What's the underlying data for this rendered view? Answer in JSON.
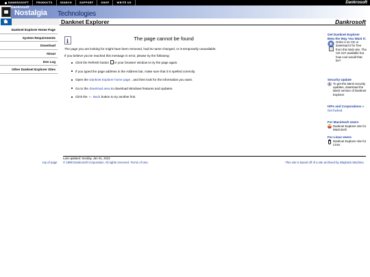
{
  "topnav": {
    "items": [
      "DANKROSOFT",
      "PRODUCTS",
      "SEARCH",
      "SUPPORT",
      "SHOP",
      "WRITE US"
    ],
    "brand": "Dankrosoft"
  },
  "banner": {
    "small_text": "Dankrosoft",
    "title_part1": "Nostalgia",
    "title_part2": "Technologies"
  },
  "titlebar": {
    "page_title": "Danknet Explorer",
    "brand": "Dankrosoft"
  },
  "leftnav": {
    "items": [
      "Danknet Explorer Home Page",
      "System Requirements",
      "Download",
      "About",
      "Dev Log",
      "Other Danknet Explorer Sites"
    ]
  },
  "main": {
    "heading": "The page cannot be found",
    "para1": "The page you are looking for might have been removed, had its name changed, or is temporarily unavailable.",
    "para2": "If you believe you've reached this message in error, please try the following:",
    "bullets": {
      "b1_pre": "Click the Refresh button",
      "b1_post": "in your browser window to try the page again.",
      "b2": "If you typed the page address in the Address bar, make sure that it is spelled correctly.",
      "b3_pre": "Open the",
      "b3_link": "Danknet Explorer home page",
      "b3_post": ", and then look for the information you want.",
      "b4_pre": "Go to the",
      "b4_link": "download area",
      "b4_post": "to download Windows features and updates.",
      "b5_pre": "Click the",
      "b5_link": "Back",
      "b5_post": "button to try another link."
    }
  },
  "sidebar": {
    "s1_title": "Get Danknet Explorer Beta the Way You Want It:",
    "s1_text": "Order it on CD or download it for free from this Web site. The CD isn't available but how cool would that be?",
    "s2_title": "Security Update",
    "s2_text": "To get the latest security updates, download the latest version of Danknet Explorer",
    "s3_title": "ISPs and Corporations",
    "s3_arrow": "»",
    "s3_text": "Get fucked.",
    "s4_title": "For Macintosh Users",
    "s4_text": "Danknet Explorer site for Macintosh",
    "s5_title": "For Linux Users",
    "s5_text": "Danknet Explorer site for Linux"
  },
  "footer": {
    "updated": "Last updated: Sunday, Jan 01, 2022",
    "top_of_page": "top of page",
    "copyright": "© 1998 Dankrosoft Corporation. All rights reserved. Terms of Use.",
    "archived": "This site is based off of a site archived by Wayback Machine."
  },
  "colors": {
    "link": "#1a3a9e",
    "banner_blue": "#6f87c4",
    "home_blue": "#0a5fa8"
  }
}
